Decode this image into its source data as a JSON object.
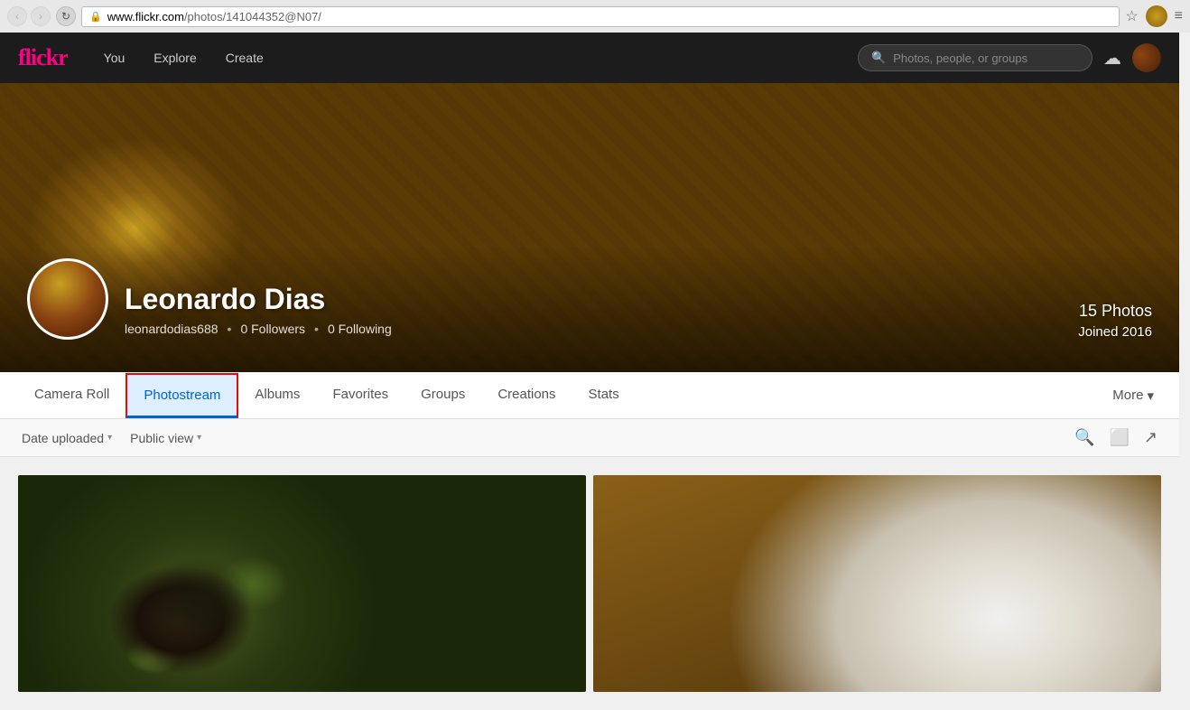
{
  "browser": {
    "url_protocol": "https://",
    "url_host": "www.flickr.com",
    "url_path": "/photos/141044352@N07/",
    "url_full": "https://www.flickr.com/photos/141044352@N07/"
  },
  "navbar": {
    "logo": "flickr",
    "you_label": "You",
    "explore_label": "Explore",
    "create_label": "Create",
    "search_placeholder": "Photos, people, or groups"
  },
  "profile": {
    "name": "Leonardo Dias",
    "username": "leonardodias688",
    "followers": "0 Followers",
    "following": "0 Following",
    "photos_count": "15 Photos",
    "joined": "Joined 2016"
  },
  "tabs": {
    "camera_roll": "Camera Roll",
    "photostream": "Photostream",
    "albums": "Albums",
    "favorites": "Favorites",
    "groups": "Groups",
    "creations": "Creations",
    "stats": "Stats",
    "more": "More"
  },
  "filters": {
    "date_uploaded": "Date uploaded",
    "public_view": "Public view"
  },
  "icons": {
    "search": "🔍",
    "upload": "☁",
    "star": "☆",
    "chevron_down": "▾",
    "slideshow": "⬜",
    "share": "↗",
    "back": "‹",
    "forward": "›",
    "refresh": "↻",
    "lock": "🔒",
    "menu": "≡"
  }
}
